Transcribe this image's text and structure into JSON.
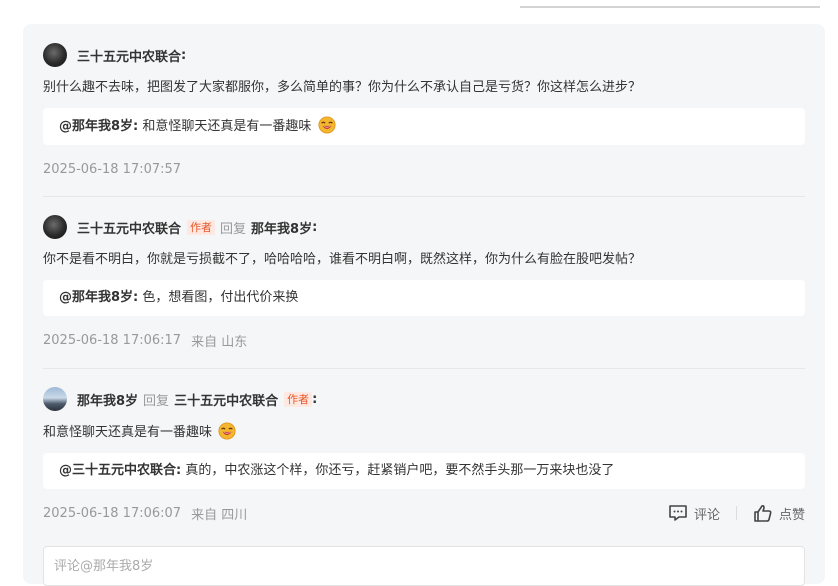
{
  "comments": [
    {
      "author": "三十五元中农联合",
      "is_author": false,
      "reply_word": "",
      "reply_to": "",
      "reply_to_is_author": false,
      "colon": ":",
      "content": "别什么趣不去味，把图发了大家都服你，多么简单的事？你为什么不承认自己是亏货？你这样怎么进步？",
      "content_emoji": false,
      "quote_name": "@那年我8岁:",
      "quote_text": "和意怪聊天还真是有一番趣味",
      "quote_emoji": true,
      "time": "2025-06-18 17:07:57",
      "location": ""
    },
    {
      "author": "三十五元中农联合",
      "is_author": true,
      "author_tag": "作者",
      "reply_word": "回复",
      "reply_to": "那年我8岁",
      "reply_to_is_author": false,
      "colon": ":",
      "content": "你不是看不明白，你就是亏损截不了，哈哈哈哈，谁看不明白啊，既然这样，你为什么有脸在股吧发帖？",
      "content_emoji": false,
      "quote_name": "@那年我8岁:",
      "quote_text": "色，想看图，付出代价来换",
      "quote_emoji": false,
      "time": "2025-06-18 17:06:17",
      "location": "来自 山东"
    },
    {
      "author": "那年我8岁",
      "is_author": false,
      "reply_word": "回复",
      "reply_to": "三十五元中农联合",
      "reply_to_is_author": true,
      "reply_to_tag": "作者",
      "colon": ":",
      "content": "和意怪聊天还真是有一番趣味",
      "content_emoji": true,
      "quote_name": "@三十五元中农联合:",
      "quote_text": "真的，中农涨这个样，你还亏，赶紧销户吧，要不然手头那一万来块也没了",
      "quote_emoji": false,
      "time": "2025-06-18 17:06:07",
      "location": "来自 四川"
    }
  ],
  "actions": {
    "comment_label": "评论",
    "like_label": "点赞"
  },
  "comment_input": {
    "placeholder": "评论@那年我8岁"
  },
  "colors": {
    "panel_bg": "#f5f6f7",
    "author_tag": "#e8572a",
    "muted": "#999999"
  },
  "icons": {
    "comment": "comment-icon",
    "like": "thumbs-up-icon",
    "emoji": "laughing-emoji-icon"
  }
}
